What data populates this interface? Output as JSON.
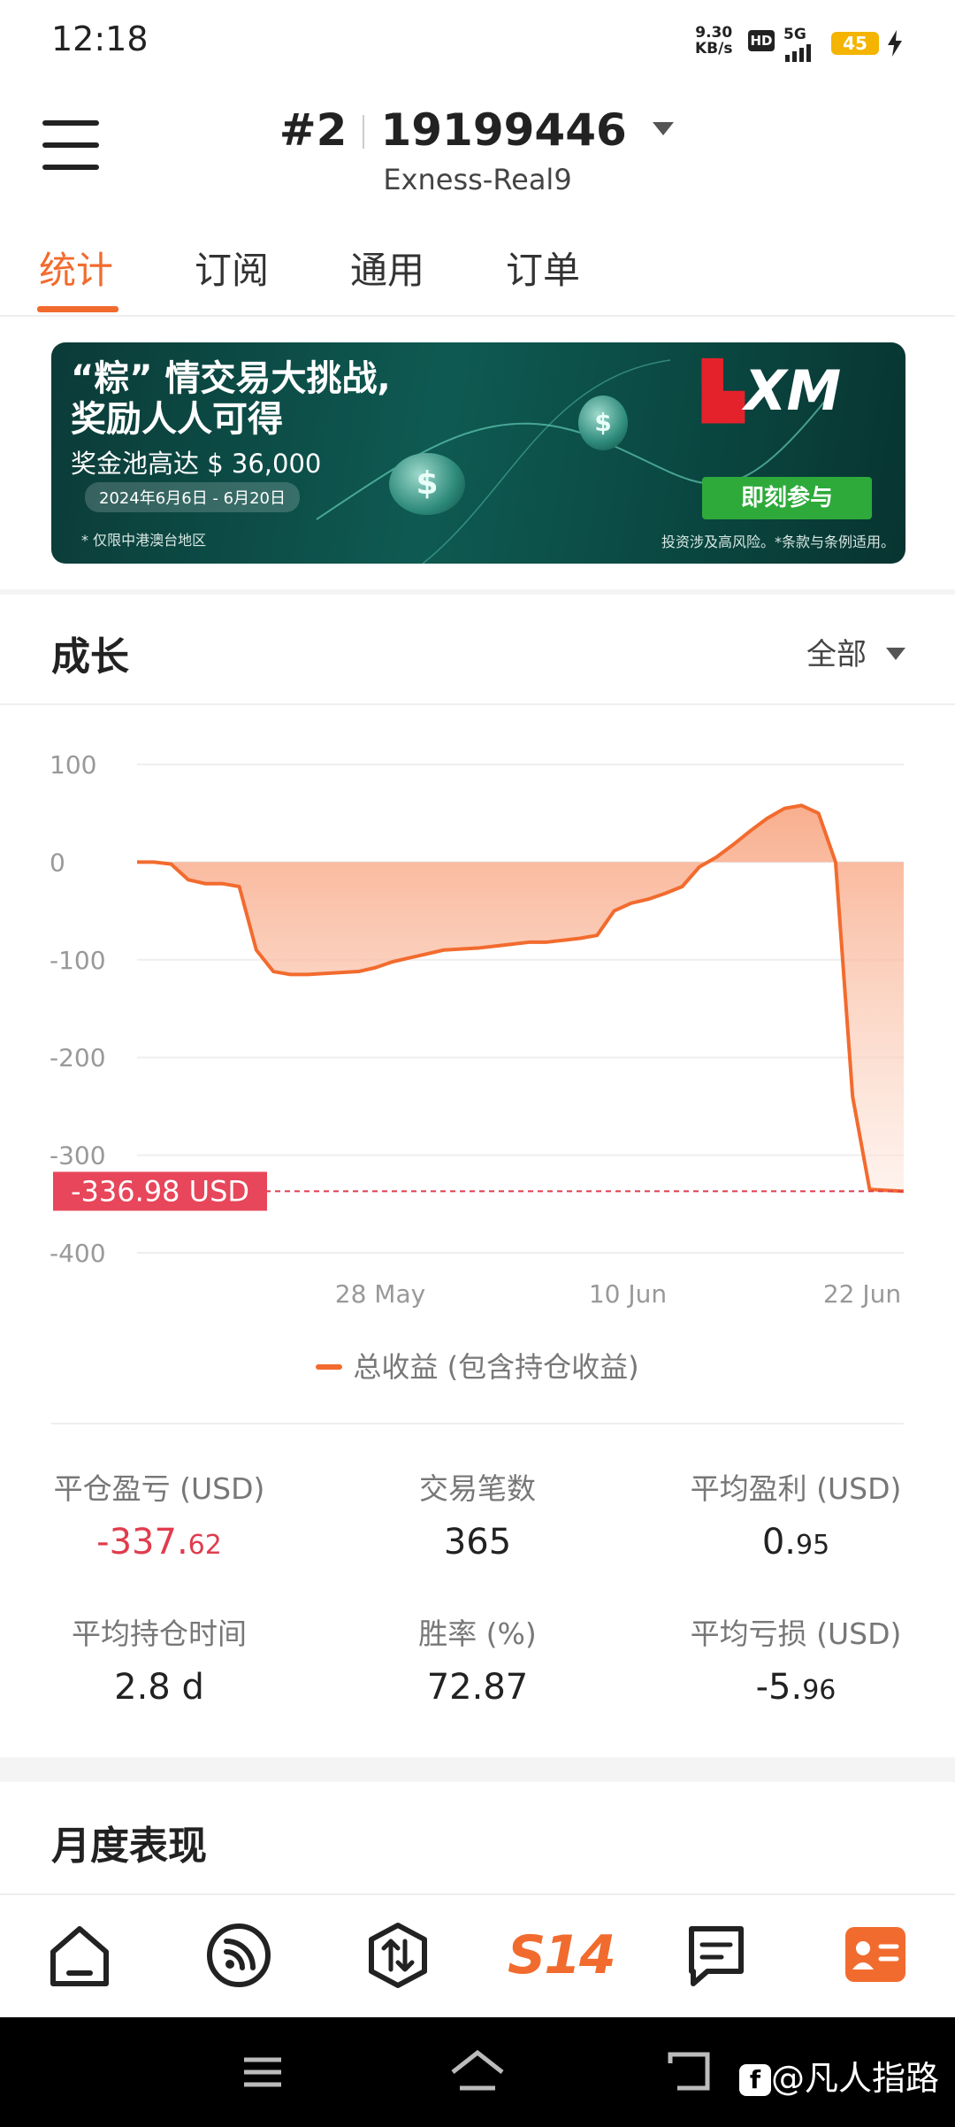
{
  "status_bar": {
    "time": "12:18",
    "net_speed_value": "9.30",
    "net_speed_unit": "KB/s",
    "hd_label": "HD",
    "network_label": "5G",
    "battery_level": "45"
  },
  "header": {
    "account_index": "#2",
    "account_number": "19199446",
    "server": "Exness-Real9"
  },
  "tabs": [
    {
      "label": "统计",
      "active": true
    },
    {
      "label": "订阅",
      "active": false
    },
    {
      "label": "通用",
      "active": false
    },
    {
      "label": "订单",
      "active": false
    }
  ],
  "banner": {
    "headline_line1": "“粽” 情交易大挑战,",
    "headline_line2": "奖励人人可得",
    "prize_text": "奖金池高达 $ 36,000",
    "date_range": "2024年6月6日 - 6月20日",
    "region_note": "* 仅限中港澳台地区",
    "logo_text": "XM",
    "cta_label": "即刻参与",
    "disclaimer": "投资涉及高风险。*条款与条例适用。"
  },
  "growth": {
    "title": "成长",
    "range_label": "全部"
  },
  "chart_data": {
    "type": "area",
    "yticks": [
      100,
      0,
      -100,
      -200,
      -300,
      -400
    ],
    "ylim": [
      -400,
      100
    ],
    "xtick_labels": [
      "28 May",
      "10 Jun",
      "22 Jun"
    ],
    "current_value_label": "-336.98 USD",
    "current_value": -336.98,
    "series": [
      {
        "name": "总收益 (包含持仓收益)",
        "color": "#f26b2e",
        "values": [
          0,
          0,
          -2,
          -18,
          -22,
          -22,
          -25,
          -90,
          -112,
          -115,
          -115,
          -114,
          -113,
          -112,
          -108,
          -102,
          -98,
          -94,
          -90,
          -89,
          -88,
          -86,
          -84,
          -82,
          -82,
          -80,
          -78,
          -75,
          -50,
          -42,
          -38,
          -32,
          -25,
          -5,
          5,
          18,
          32,
          45,
          55,
          58,
          50,
          0,
          -240,
          -335,
          -336,
          -336.98
        ]
      }
    ]
  },
  "legend_label": "总收益 (包含持仓收益)",
  "stats": [
    {
      "label": "平仓盈亏 (USD)",
      "int": "-337.",
      "dec": "62",
      "negative": true
    },
    {
      "label": "交易笔数",
      "int": "365",
      "dec": "",
      "negative": false
    },
    {
      "label": "平均盈利 (USD)",
      "int": "0.",
      "dec": "95",
      "negative": false
    },
    {
      "label": "平均持仓时间",
      "int": "2.8 d",
      "dec": "",
      "negative": false
    },
    {
      "label": "胜率 (%)",
      "int": "72.87",
      "dec": "",
      "negative": false
    },
    {
      "label": "平均亏损 (USD)",
      "int": "-5.",
      "dec": "96",
      "negative": false
    }
  ],
  "monthly": {
    "title": "月度表现"
  },
  "bottom_nav": {
    "s14_label": "S14"
  },
  "watermark": {
    "text": "@凡人指路"
  }
}
